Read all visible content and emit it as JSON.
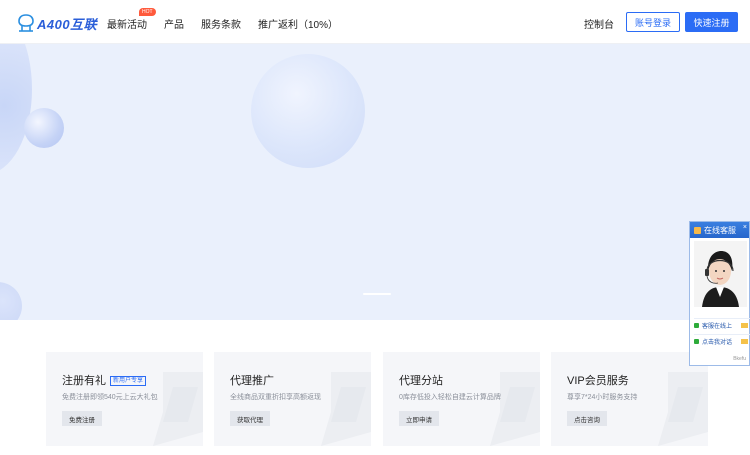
{
  "header": {
    "logo_text": "A400互联",
    "nav": [
      {
        "label": "最新活动",
        "badge": "HOT"
      },
      {
        "label": "产品"
      },
      {
        "label": "服务条款"
      },
      {
        "label": "推广返利（10%）"
      }
    ],
    "console": "控制台",
    "login": "账号登录",
    "register": "快速注册"
  },
  "cards": [
    {
      "title": "注册有礼",
      "tag": "新用户专享",
      "desc": "免费注册即领540元上云大礼包",
      "button": "免费注册"
    },
    {
      "title": "代理推广",
      "desc": "全线商品双重折扣享高额返现",
      "button": "获取代理"
    },
    {
      "title": "代理分站",
      "desc": "0库存低投入轻松自建云计算品牌",
      "button": "立即申请"
    },
    {
      "title": "VIP会员服务",
      "desc": "尊享7*24小时服务支持",
      "button": "点击咨询"
    }
  ],
  "cs_widget": {
    "title": "在线客服",
    "close": "×",
    "rows": [
      "客服在线上",
      "点击我对话"
    ],
    "footer": "Bkefu"
  },
  "colors": {
    "accent": "#2b6cf5",
    "banner_bg": "#eaf0fc",
    "hot": "#ff5a3c"
  }
}
